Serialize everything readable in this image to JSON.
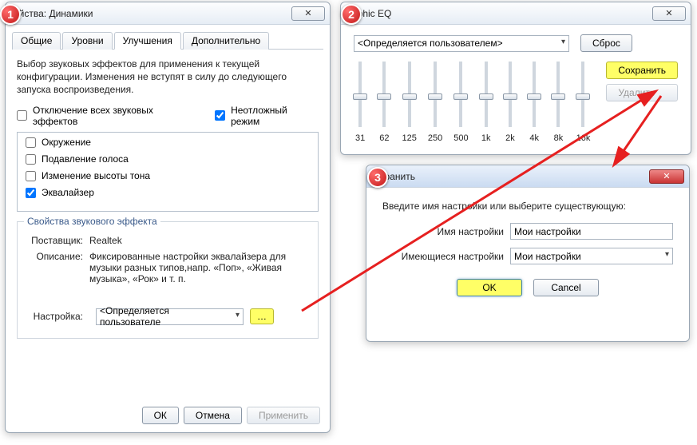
{
  "badges": {
    "b1": "1",
    "b2": "2",
    "b3": "3"
  },
  "props": {
    "title": "ойства: Динамики",
    "close": "✕",
    "tabs": [
      "Общие",
      "Уровни",
      "Улучшения",
      "Дополнительно"
    ],
    "activeTab": 2,
    "desc": "Выбор звуковых эффектов для применения к текущей конфигурации. Изменения не вступят в силу до следующего запуска воспроизведения.",
    "disableAll": "Отключение всех звуковых эффектов",
    "immediate": "Неотложный режим",
    "immediateChecked": true,
    "effects": [
      {
        "label": "Окружение",
        "checked": false
      },
      {
        "label": "Подавление голоса",
        "checked": false
      },
      {
        "label": "Изменение высоты тона",
        "checked": false
      },
      {
        "label": "Эквалайзер",
        "checked": true
      }
    ],
    "groupLegend": "Свойства звукового эффекта",
    "vendorLabel": "Поставщик:",
    "vendorVal": "Realtek",
    "descLabel": "Описание:",
    "descVal": "Фиксированные настройки эквалайзера для музыки разных типов,напр. «Поп», «Живая музыка», «Рок» и т. п.",
    "settingLabel": "Настройка:",
    "settingVal": "<Определяется пользователе",
    "dotsBtn": "…",
    "ok": "ОК",
    "cancel": "Отмена",
    "apply": "Применить"
  },
  "eq": {
    "title": "raphic EQ",
    "close": "✕",
    "preset": "<Определяется пользователем>",
    "reset": "Сброс",
    "save": "Сохранить",
    "delete": "Удалить",
    "bands": [
      {
        "freq": "31",
        "pos": 40
      },
      {
        "freq": "62",
        "pos": 40
      },
      {
        "freq": "125",
        "pos": 40
      },
      {
        "freq": "250",
        "pos": 40
      },
      {
        "freq": "500",
        "pos": 40
      },
      {
        "freq": "1k",
        "pos": 40
      },
      {
        "freq": "2k",
        "pos": 40
      },
      {
        "freq": "4k",
        "pos": 40
      },
      {
        "freq": "8k",
        "pos": 40
      },
      {
        "freq": "16k",
        "pos": 40
      }
    ]
  },
  "save": {
    "title": "охранить",
    "close": "✕",
    "prompt": "Введите имя настройки или выберите существующую:",
    "nameLabel": "Имя настройки",
    "nameVal": "Мои настройки",
    "existLabel": "Имеющиеся настройки",
    "existVal": "Мои настройки",
    "ok": "OK",
    "cancel": "Cancel"
  }
}
